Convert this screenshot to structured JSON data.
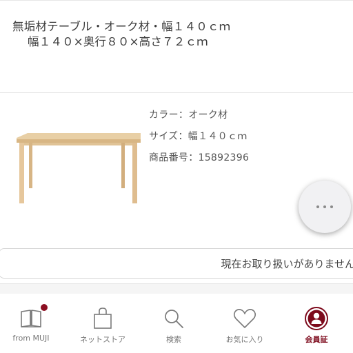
{
  "product": {
    "title_line1": "無垢材テーブル・オーク材・幅１４０ｃｍ",
    "title_line2": "幅１４０×奥行８０×高さ７２ｃｍ"
  },
  "specs": {
    "color": "カラー：オーク材",
    "size": "サイズ：幅１４０ｃｍ",
    "item_number": "商品番号：15892396"
  },
  "availability": {
    "status_text": "現在お取り扱いがありません"
  },
  "tabbar": {
    "tabs": [
      {
        "label": "from MUJI",
        "icon": "book-icon",
        "has_badge": true
      },
      {
        "label": "ネットストア",
        "icon": "shopping-bag-icon"
      },
      {
        "label": "検索",
        "icon": "search-icon"
      },
      {
        "label": "お気に入り",
        "icon": "heart-icon"
      },
      {
        "label": "会員証",
        "icon": "member-card-icon",
        "active": true
      }
    ]
  },
  "colors": {
    "accent": "#7d0a1c",
    "badge": "#8c0f22",
    "table_wood": "#e6c79c"
  }
}
